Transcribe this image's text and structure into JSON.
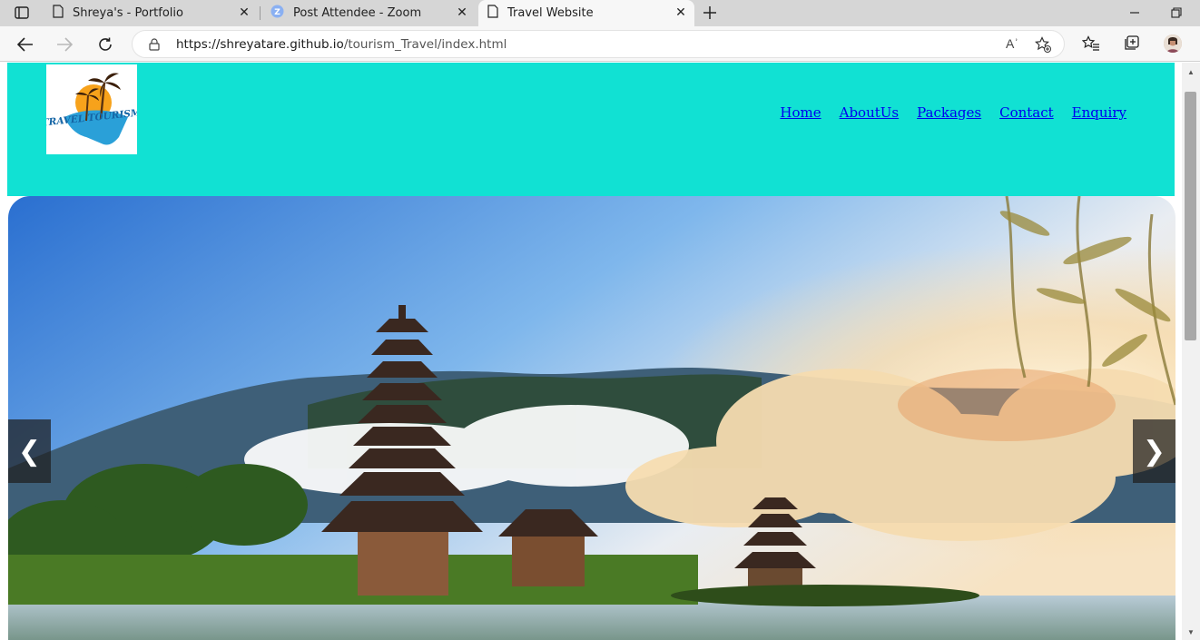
{
  "browser": {
    "tabs": [
      {
        "title": "Shreya's - Portfolio"
      },
      {
        "title": "Post Attendee - Zoom"
      },
      {
        "title": "Travel Website"
      }
    ],
    "url_host": "https://shreyatare.github.io",
    "url_path": "/tourism_Travel/index.html",
    "readaloud_label": "Aʾ"
  },
  "site": {
    "logo_text": "TRAVEL TOURISM",
    "nav": [
      "Home",
      "AboutUs",
      "Packages",
      "Contact",
      "Enquiry"
    ],
    "slider": {
      "prev_label": "❮",
      "next_label": "❯"
    }
  },
  "colors": {
    "header_bg": "#11e1d3",
    "link": "#0000ee",
    "sky_top": "#2f7fd6",
    "cloud": "#f3d6a6"
  }
}
